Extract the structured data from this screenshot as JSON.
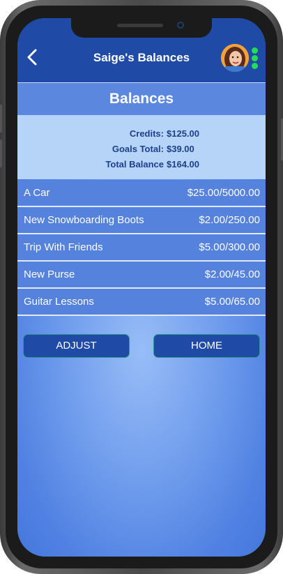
{
  "header": {
    "title": "Saige's Balances",
    "back_icon": "chevron-left-icon",
    "menu_icon": "vertical-dots-icon",
    "color": "#1f4aa6"
  },
  "section": {
    "title": "Balances"
  },
  "summary": {
    "credits_label": "Credits:",
    "credits_value": "$125.00",
    "goals_label": "Goals Total:",
    "goals_value": "$39.00",
    "total_label": "Total Balance",
    "total_value": "$164.00"
  },
  "goals": [
    {
      "name": "A Car",
      "amount": "$25.00/5000.00"
    },
    {
      "name": "New Snowboarding Boots",
      "amount": "$2.00/250.00"
    },
    {
      "name": "Trip With Friends",
      "amount": "$5.00/300.00"
    },
    {
      "name": "New Purse",
      "amount": "$2.00/45.00"
    },
    {
      "name": "Guitar Lessons",
      "amount": "$5.00/65.00"
    }
  ],
  "buttons": {
    "adjust": "ADJUST",
    "home": "HOME"
  },
  "colors": {
    "accent": "#1f4aa6",
    "row": "#5582dd",
    "summary_bg": "#b5d4f8",
    "summary_text": "#1e3f8c",
    "status_dots": "#22dd55"
  }
}
